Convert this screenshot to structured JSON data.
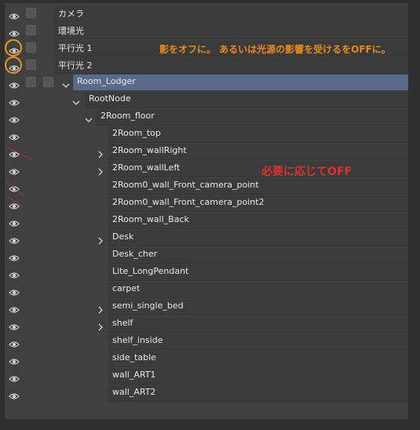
{
  "rows": [
    {
      "label": "カメラ",
      "boxes": 1
    },
    {
      "label": "環境光",
      "boxes": 1
    },
    {
      "label": "平行光 1",
      "boxes": 1
    },
    {
      "label": "平行光 2",
      "boxes": 1
    },
    {
      "label": "Room_Lodger",
      "boxes": 2,
      "expand": "open",
      "selected": true
    },
    {
      "label": "RootNode",
      "expand": "open"
    },
    {
      "label": "2Room_floor",
      "expand": "open"
    },
    {
      "label": "2Room_top"
    },
    {
      "label": "2Room_wallRight",
      "expand": "closed"
    },
    {
      "label": "2Room_wallLeft",
      "expand": "closed"
    },
    {
      "label": "2Room0_wall_Front_camera_point"
    },
    {
      "label": "2Room0_wall_Front_camera_point2"
    },
    {
      "label": "2Room_wall_Back"
    },
    {
      "label": "Desk",
      "expand": "closed"
    },
    {
      "label": "Desk_cher"
    },
    {
      "label": "Lite_LongPendant"
    },
    {
      "label": "carpet"
    },
    {
      "label": "semi_single_bed",
      "expand": "closed"
    },
    {
      "label": "shelf",
      "expand": "closed"
    },
    {
      "label": "shelf_inside"
    },
    {
      "label": "side_table"
    },
    {
      "label": "wall_ART1"
    },
    {
      "label": "wall_ART2"
    }
  ],
  "annotations": {
    "light_note": "影をオフに。 あるいは光源の影響を受けるをOFFに。",
    "off_note": "必要に応じてOFF"
  },
  "colors": {
    "highlight_orange": "#e8961e",
    "note_red": "#e0302a",
    "selected_row": "#5a6a8a"
  }
}
